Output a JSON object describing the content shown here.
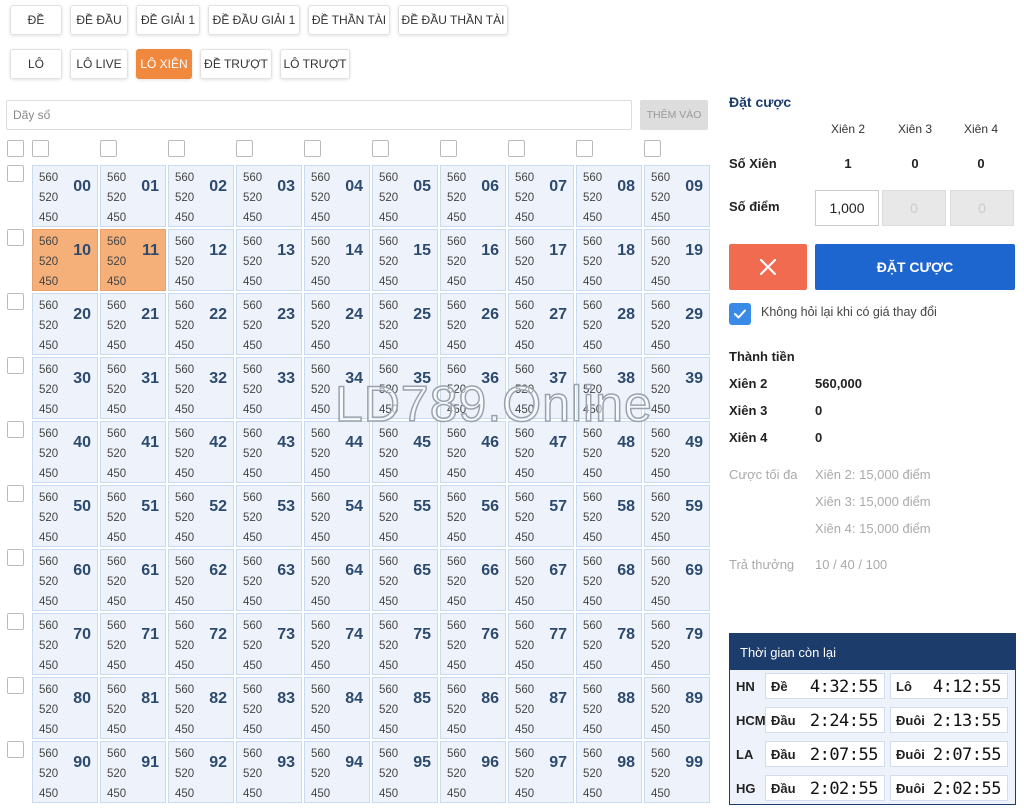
{
  "tabs_row1": [
    "ĐỀ",
    "ĐỀ ĐẦU",
    "ĐỀ GIẢI 1",
    "ĐỀ ĐẦU GIẢI 1",
    "ĐỀ THẦN TÀI",
    "ĐỀ ĐẦU THẦN TÀI"
  ],
  "tabs_row2": [
    "LÔ",
    "LÔ LIVE",
    "LÔ XIÊN",
    "ĐỀ TRƯỢT",
    "LÔ TRƯỢT"
  ],
  "active_tab": "LÔ XIÊN",
  "search": {
    "placeholder": "Dãy số",
    "add_label": "THÊM VÀO"
  },
  "odds": [
    "560",
    "520",
    "450"
  ],
  "numbers": [
    "00",
    "01",
    "02",
    "03",
    "04",
    "05",
    "06",
    "07",
    "08",
    "09",
    "10",
    "11",
    "12",
    "13",
    "14",
    "15",
    "16",
    "17",
    "18",
    "19",
    "20",
    "21",
    "22",
    "23",
    "24",
    "25",
    "26",
    "27",
    "28",
    "29",
    "30",
    "31",
    "32",
    "33",
    "34",
    "35",
    "36",
    "37",
    "38",
    "39",
    "40",
    "41",
    "42",
    "43",
    "44",
    "45",
    "46",
    "47",
    "48",
    "49",
    "50",
    "51",
    "52",
    "53",
    "54",
    "55",
    "56",
    "57",
    "58",
    "59",
    "60",
    "61",
    "62",
    "63",
    "64",
    "65",
    "66",
    "67",
    "68",
    "69",
    "70",
    "71",
    "72",
    "73",
    "74",
    "75",
    "76",
    "77",
    "78",
    "79",
    "80",
    "81",
    "82",
    "83",
    "84",
    "85",
    "86",
    "87",
    "88",
    "89",
    "90",
    "91",
    "92",
    "93",
    "94",
    "95",
    "96",
    "97",
    "98",
    "99"
  ],
  "selected_numbers": [
    "10",
    "11"
  ],
  "watermark": "LD789.Online",
  "bet": {
    "title": "Đặt cược",
    "columns": [
      "Xiên 2",
      "Xiên 3",
      "Xiên 4"
    ],
    "so_xien_label": "Số Xiên",
    "so_xien_values": [
      "1",
      "0",
      "0"
    ],
    "so_diem_label": "Số điểm",
    "so_diem_values": [
      "1,000",
      "0",
      "0"
    ],
    "cancel_icon": "close-icon",
    "submit_label": "ĐẶT CƯỢC",
    "no_ask_label": "Không hỏi lại khi có giá thay đổi",
    "no_ask_checked": true
  },
  "total": {
    "title": "Thành tiền",
    "rows": [
      {
        "label": "Xiên 2",
        "value": "560,000"
      },
      {
        "label": "Xiên 3",
        "value": "0"
      },
      {
        "label": "Xiên 4",
        "value": "0"
      }
    ]
  },
  "max_bet": {
    "label": "Cược tối đa",
    "values": [
      "Xiên 2: 15,000 điểm",
      "Xiên 3: 15,000 điểm",
      "Xiên 4: 15,000 điểm"
    ]
  },
  "payout": {
    "label": "Trả thưởng",
    "value": "10 / 40 / 100"
  },
  "timer": {
    "title": "Thời gian còn lại",
    "rows": [
      {
        "code": "HN",
        "l1": "Đề",
        "t1": "4:32:55",
        "l2": "Lô",
        "t2": "4:12:55"
      },
      {
        "code": "HCM",
        "l1": "Đầu",
        "t1": "2:24:55",
        "l2": "Đuôi",
        "t2": "2:13:55"
      },
      {
        "code": "LA",
        "l1": "Đầu",
        "t1": "2:07:55",
        "l2": "Đuôi",
        "t2": "2:07:55"
      },
      {
        "code": "HG",
        "l1": "Đầu",
        "t1": "2:02:55",
        "l2": "Đuôi",
        "t2": "2:02:55"
      }
    ]
  },
  "colors": {
    "accent": "#f0883e",
    "primary": "#1e66cf",
    "danger": "#f06b4f",
    "navy": "#1c3c6b",
    "cell_bg": "#eef3fb",
    "cell_selected": "#f5b07a"
  }
}
